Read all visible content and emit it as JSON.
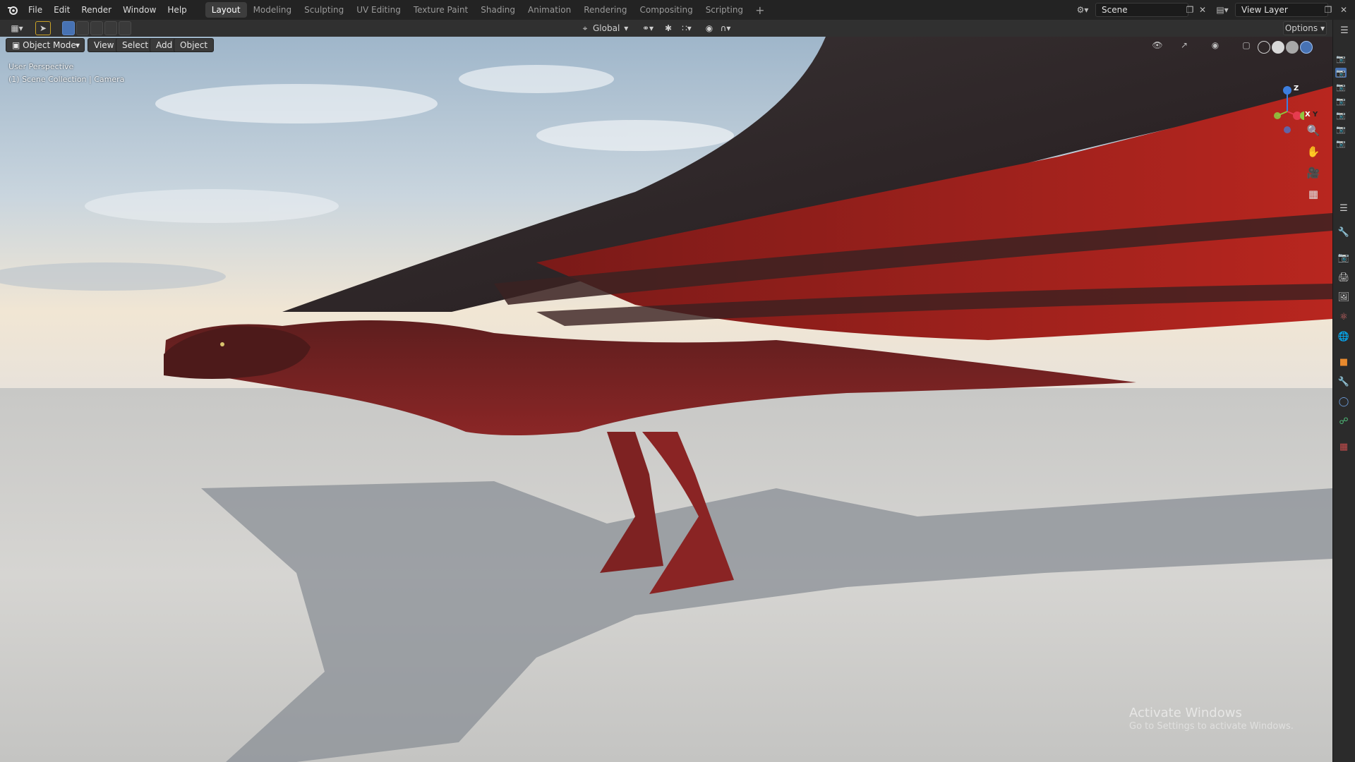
{
  "app": {
    "logo": "blender-logo-icon"
  },
  "menu": [
    "File",
    "Edit",
    "Render",
    "Window",
    "Help"
  ],
  "workspaces": [
    {
      "label": "Layout",
      "active": true
    },
    {
      "label": "Modeling"
    },
    {
      "label": "Sculpting"
    },
    {
      "label": "UV Editing"
    },
    {
      "label": "Texture Paint"
    },
    {
      "label": "Shading"
    },
    {
      "label": "Animation"
    },
    {
      "label": "Rendering"
    },
    {
      "label": "Compositing"
    },
    {
      "label": "Scripting"
    }
  ],
  "scene": {
    "name": "Scene",
    "view_layer": "View Layer"
  },
  "header": {
    "transform_orientation": "Global",
    "options_label": "Options"
  },
  "viewport": {
    "mode_label": "Object Mode",
    "view_label": "View",
    "select_label": "Select",
    "add_label": "Add",
    "object_label": "Object",
    "perspective_text": "User Perspective",
    "collection_text": "(1) Scene Collection | Camera",
    "gizmo": {
      "x": "X",
      "y": "Y",
      "z": "Z"
    }
  },
  "watermark": {
    "title": "Activate Windows",
    "subtitle": "Go to Settings to activate Windows."
  },
  "colors": {
    "accent": "#4772b3",
    "axis_x": "#e63b4f",
    "axis_y": "#8ec63f",
    "axis_z": "#3d7fe0",
    "dragon_red": "#8e1d1d"
  }
}
